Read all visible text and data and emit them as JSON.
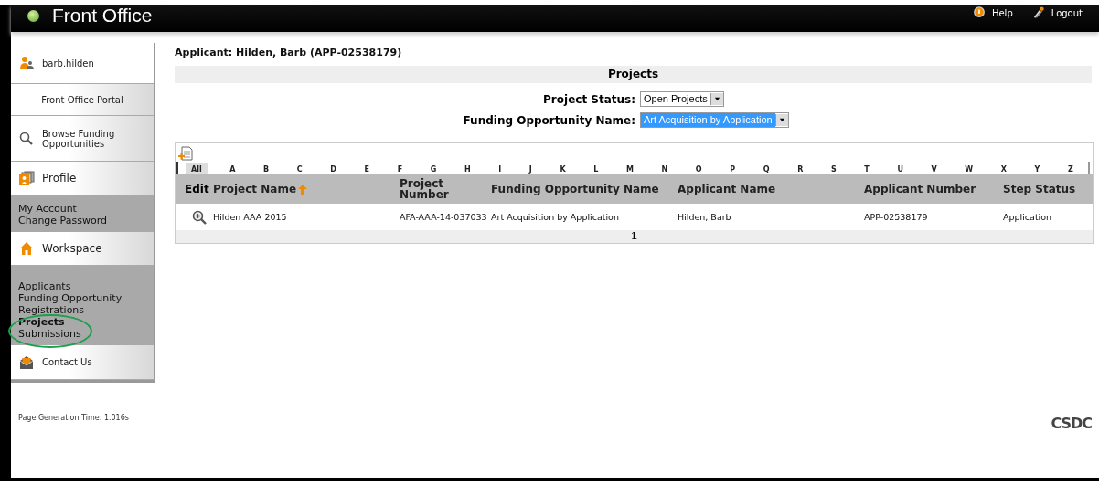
{
  "header": {
    "title": "Front Office",
    "links": [
      {
        "kind": "help",
        "label": "Help"
      },
      {
        "kind": "logout",
        "label": "Logout"
      }
    ]
  },
  "sidebar": [
    {
      "kind": "user",
      "label": "barb.hilden"
    },
    {
      "kind": "portal",
      "label": "Front Office Portal"
    },
    {
      "kind": "browse",
      "label": "Browse Funding Opportunities"
    },
    {
      "kind": "profile",
      "label": "Profile",
      "children": [
        {
          "label": "My Account",
          "selected": false
        },
        {
          "label": "Change Password",
          "selected": false
        }
      ]
    },
    {
      "kind": "workspace",
      "label": "Workspace",
      "children": [
        {
          "label": "Applicants",
          "selected": false
        },
        {
          "label": "Funding Opportunity Registrations",
          "selected": false
        },
        {
          "label": "Projects",
          "selected": true
        },
        {
          "label": "Submissions",
          "selected": false
        }
      ]
    },
    {
      "kind": "contact",
      "label": "Contact Us"
    }
  ],
  "page_generation": "Page Generation Time: 1.016s",
  "applicant_title": "Applicant: Hilden, Barb (APP-02538179)",
  "section_title": "Projects",
  "filters": [
    {
      "label": "Project Status:",
      "value": "Open Projects",
      "focused": false
    },
    {
      "label": "Funding Opportunity Name:",
      "value": "Art Acquisition by Application",
      "focused": true
    }
  ],
  "letters": [
    {
      "label": "All",
      "selected": true
    },
    {
      "label": "A",
      "selected": false
    },
    {
      "label": "B",
      "selected": false
    },
    {
      "label": "C",
      "selected": false
    },
    {
      "label": "D",
      "selected": false
    },
    {
      "label": "E",
      "selected": false
    },
    {
      "label": "F",
      "selected": false
    },
    {
      "label": "G",
      "selected": false
    },
    {
      "label": "H",
      "selected": false
    },
    {
      "label": "I",
      "selected": false
    },
    {
      "label": "J",
      "selected": false
    },
    {
      "label": "K",
      "selected": false
    },
    {
      "label": "L",
      "selected": false
    },
    {
      "label": "M",
      "selected": false
    },
    {
      "label": "N",
      "selected": false
    },
    {
      "label": "O",
      "selected": false
    },
    {
      "label": "P",
      "selected": false
    },
    {
      "label": "Q",
      "selected": false
    },
    {
      "label": "R",
      "selected": false
    },
    {
      "label": "S",
      "selected": false
    },
    {
      "label": "T",
      "selected": false
    },
    {
      "label": "U",
      "selected": false
    },
    {
      "label": "V",
      "selected": false
    },
    {
      "label": "W",
      "selected": false
    },
    {
      "label": "X",
      "selected": false
    },
    {
      "label": "Y",
      "selected": false
    },
    {
      "label": "Z",
      "selected": false
    }
  ],
  "table": {
    "edit_label": "Edit",
    "columns": [
      {
        "label": "Project Name",
        "sorted": true
      },
      {
        "label": "Project Number",
        "sorted": false
      },
      {
        "label": "Funding Opportunity Name",
        "sorted": false
      },
      {
        "label": "Applicant Name",
        "sorted": false
      },
      {
        "label": "Applicant Number",
        "sorted": false
      },
      {
        "label": "Step Status",
        "sorted": false
      }
    ],
    "rows": [
      [
        "Hilden AAA 2015",
        "AFA-AAA-14-037033",
        "Art Acquisition by Application",
        "Hilden, Barb",
        "APP-02538179",
        "Application"
      ]
    ],
    "pages": [
      {
        "label": "1",
        "selected": true
      }
    ]
  },
  "logo": "CSDC"
}
